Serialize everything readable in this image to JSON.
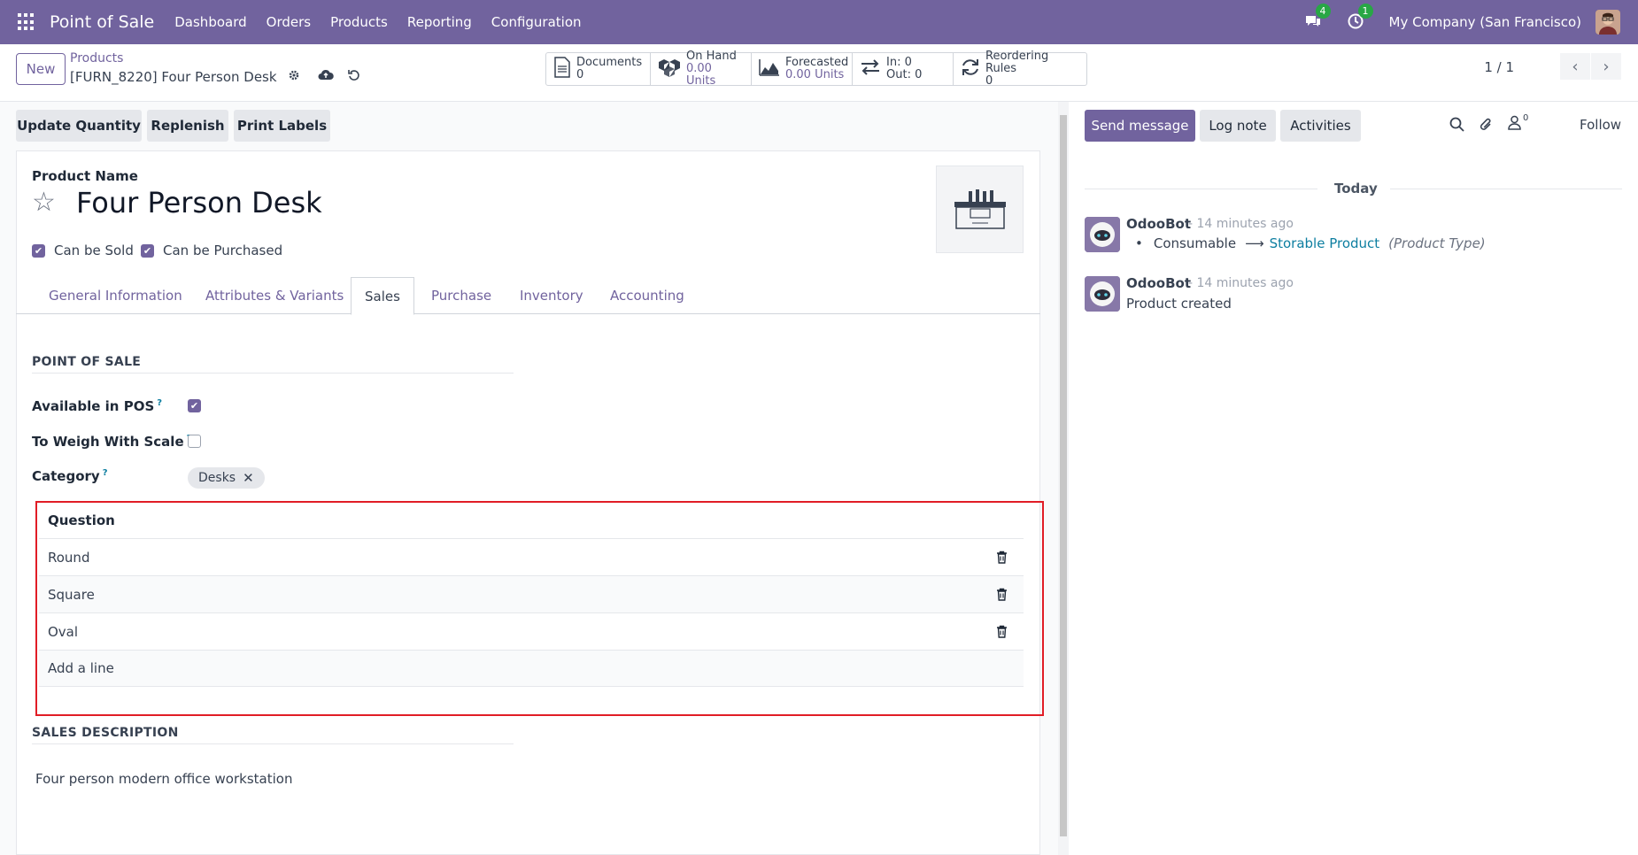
{
  "navbar": {
    "app_name": "Point of Sale",
    "menu": [
      "Dashboard",
      "Orders",
      "Products",
      "Reporting",
      "Configuration"
    ],
    "messages_badge": "4",
    "activities_badge": "1",
    "company": "My Company (San Francisco)"
  },
  "control_panel": {
    "new_label": "New",
    "breadcrumb_parent": "Products",
    "breadcrumb_current": "[FURN_8220] Four Person Desk",
    "pager": "1 / 1",
    "smart_buttons": {
      "documents": {
        "label": "Documents",
        "value": "0"
      },
      "on_hand": {
        "label": "On Hand",
        "value": "0.00 Units"
      },
      "forecasted": {
        "label": "Forecasted",
        "value": "0.00 Units"
      },
      "in_out": {
        "in": "In: 0",
        "out": "Out: 0"
      },
      "reordering": {
        "label": "Reordering Rules",
        "value": "0"
      }
    }
  },
  "actions": {
    "update_quantity": "Update Quantity",
    "replenish": "Replenish",
    "print_labels": "Print Labels"
  },
  "form": {
    "product_name_label": "Product Name",
    "product_name": "Four Person Desk",
    "can_be_sold": "Can be Sold",
    "can_be_purchased": "Can be Purchased",
    "tabs": [
      "General Information",
      "Attributes & Variants",
      "Sales",
      "Purchase",
      "Inventory",
      "Accounting"
    ],
    "active_tab": "Sales",
    "pos_section": "POINT OF SALE",
    "available_in_pos": "Available in POS",
    "to_weigh": "To Weigh With Scale",
    "category_label": "Category",
    "category_tag": "Desks",
    "help_mark": "?",
    "question_header": "Question",
    "questions": [
      "Round",
      "Square",
      "Oval"
    ],
    "add_line": "Add a line",
    "sales_desc_section": "SALES DESCRIPTION",
    "sales_description": "Four person modern office workstation"
  },
  "chatter": {
    "send_message": "Send message",
    "log_note": "Log note",
    "activities": "Activities",
    "followers_count": "0",
    "follow": "Follow",
    "date_separator": "Today",
    "messages": [
      {
        "author": "OdooBot",
        "time": "- 14 minutes ago",
        "old_value": "Consumable",
        "new_value": "Storable Product",
        "field": "(Product Type)"
      },
      {
        "author": "OdooBot",
        "time": "- 14 minutes ago",
        "body": "Product created"
      }
    ]
  },
  "colors": {
    "brand": "#71639e",
    "highlight": "#e11d26",
    "link": "#0d7ea0"
  }
}
